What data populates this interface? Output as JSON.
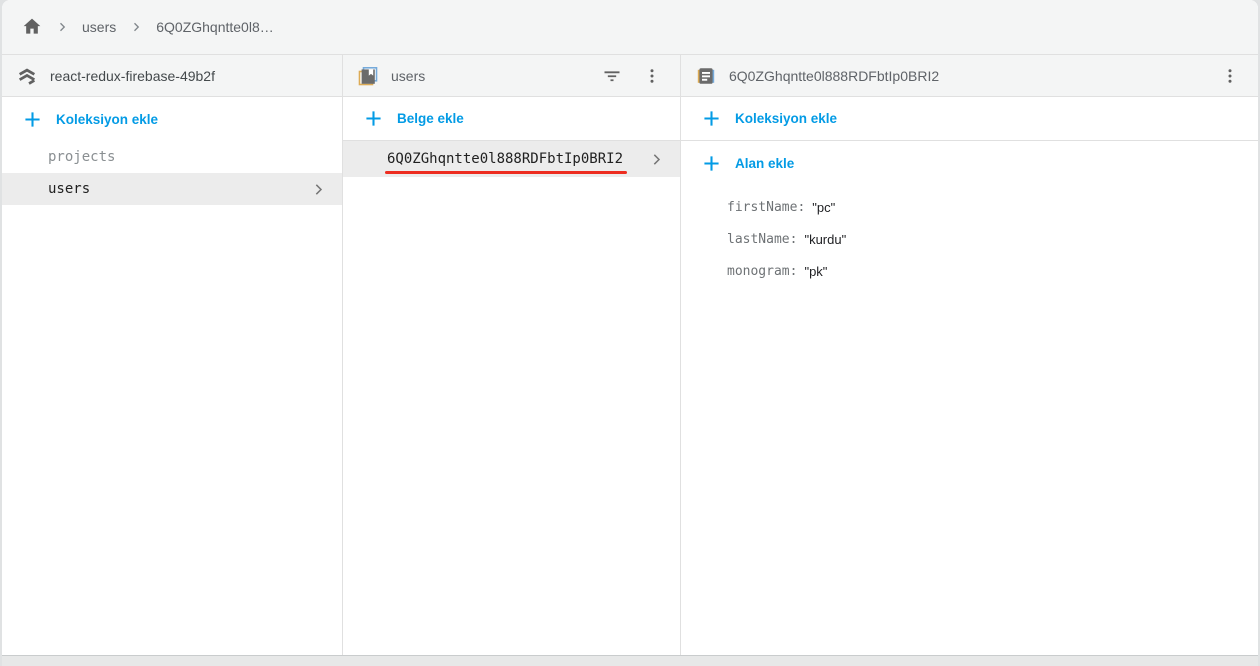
{
  "colors": {
    "accent_blue": "#039be5",
    "annotation_red": "#ed2d20",
    "selected_row_bg": "#ececec",
    "panel_header_bg": "#f4f5f5",
    "border": "#e0e0e0"
  },
  "breadcrumb": {
    "items": [
      {
        "label": "users"
      },
      {
        "label": "6Q0ZGhqntte0l8…"
      }
    ]
  },
  "panels": {
    "database": {
      "title": "react-redux-firebase-49b2f",
      "add_button_label": "Koleksiyon ekle",
      "collections": [
        {
          "name": "projects",
          "selected": false
        },
        {
          "name": "users",
          "selected": true
        }
      ]
    },
    "collection": {
      "title": "users",
      "add_button_label": "Belge ekle",
      "documents": [
        {
          "id": "6Q0ZGhqntte0l888RDFbtIp0BRI2",
          "selected": true,
          "annotated": true
        }
      ]
    },
    "document": {
      "title": "6Q0ZGhqntte0l888RDFbtIp0BRI2",
      "add_collection_button_label": "Koleksiyon ekle",
      "add_field_button_label": "Alan ekle",
      "colon": ":",
      "fields": [
        {
          "name": "firstName",
          "value": "\"pc\""
        },
        {
          "name": "lastName",
          "value": "\"kurdu\""
        },
        {
          "name": "monogram",
          "value": "\"pk\""
        }
      ]
    }
  }
}
